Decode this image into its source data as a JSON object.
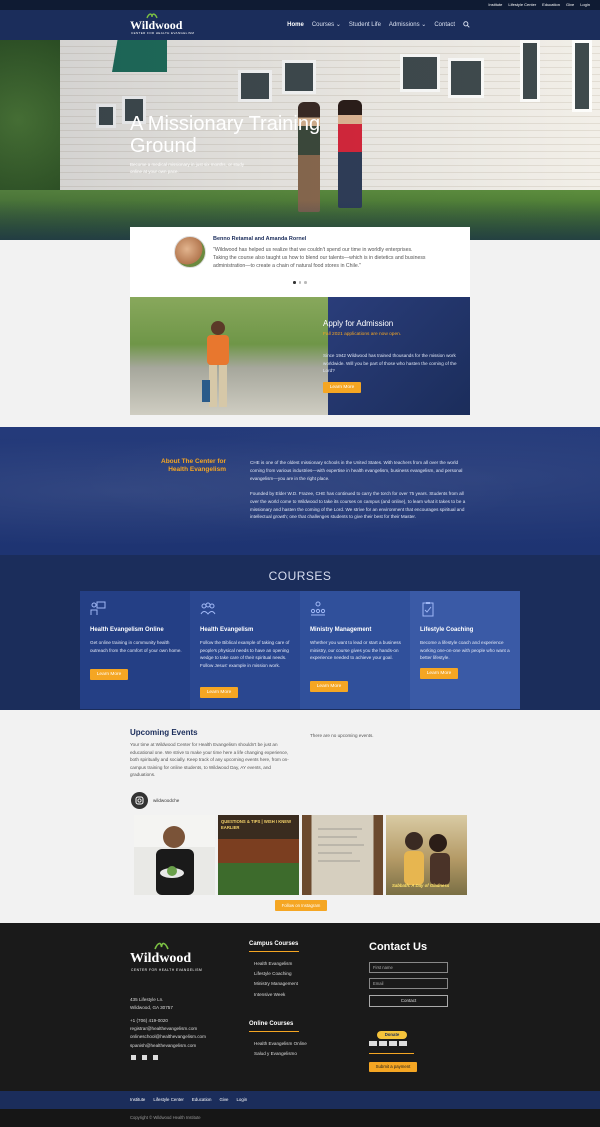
{
  "topbar": {
    "links": [
      "Institute",
      "Lifestyle Center",
      "Education",
      "Give",
      "Login"
    ]
  },
  "header": {
    "logo_word": "Wildwood",
    "logo_tagline": "CENTER FOR HEALTH EVANGELISM",
    "nav": [
      "Home",
      "Courses",
      "Student Life",
      "Admissions",
      "Contact"
    ],
    "nav_caret": "⌄"
  },
  "hero": {
    "title": "A Missionary Training Ground",
    "subtitle": "Become a medical missionary in just six months, or study online at your own pace."
  },
  "testimonial": {
    "name": "Benno Retamal and Amanda Rornel",
    "quote": "\"Wildwood has helped us realize that we couldn't spend our time in worldly enterprises. Taking the course also taught us how to blend our talents—which is in dietetics and business administration—to create a chain of natural food stores in Chile.\""
  },
  "apply": {
    "title": "Apply for Admission",
    "subtitle": "Fall 2021 applications are now open.",
    "text": "Since 1942 Wildwood has trained thousands for the mission work worldwide. Will you be part of those who hasten the coming of the Lord?",
    "button": "Learn More"
  },
  "about": {
    "title": "About The Center for Health Evangelism",
    "p1": "CHE is one of the oldest missionary schools in the United States. With teachers from all over the world coming from various industries—with expertise in health evangelism, business evangelism, and personal evangelism—you are in the right place.",
    "p2": "Founded by Elder W.D. Frazee, CHE has continued to carry the torch for over 75 years. Students from all over the world come to Wildwood to take its courses on campus (and online), to learn what it takes to be a missionary and hasten the coming of the Lord. We strive for an environment that encourages spiritual and intellectual growth; one that challenges students to give their best for their Master."
  },
  "courses": {
    "title": "COURSES",
    "items": [
      {
        "title": "Health Evangelism Online",
        "desc": "Get online training in community health outreach from the comfort of your own home.",
        "button": "Learn More",
        "bg": "#243f85",
        "icon": "online-training-icon"
      },
      {
        "title": "Health Evangelism",
        "desc": "Follow the Biblical example of taking care of people's physical needs to have an opening wedge to take care of their spiritual needs. Follow Jesus' example in mission work.",
        "button": "Learn More",
        "bg": "#2a4790",
        "icon": "group-icon"
      },
      {
        "title": "Ministry Management",
        "desc": "Whether you want to lead or start a business ministry, our course gives you the hands-on experience needed to achieve your goal.",
        "button": "Learn More",
        "bg": "#30509b",
        "icon": "team-icon"
      },
      {
        "title": "Lifestyle Coaching",
        "desc": "Become a lifestyle coach and experience working one-on-one with people who want a better lifestyle.",
        "button": "Learn More",
        "bg": "#3a5aa6",
        "icon": "clipboard-icon"
      }
    ]
  },
  "events": {
    "title": "Upcoming Events",
    "text": "Your time at Wildwood Center for Health Evangelism shouldn't be just an educational one. We strive to make your time here a life changing experience, both spiritually and socially. Keep track of any upcoming events here, from on-campus training for online students, to Wildwood Day, AY events, and graduations.",
    "empty": "There are no upcoming events.",
    "instagram_handle": "wildwoodche",
    "follow_button": "Follow on Instagram",
    "tiles": [
      {
        "icon": "photo-man-plate",
        "label": ""
      },
      {
        "icon": "photo-produce-market",
        "label": "QUESTIONS & TIPS | WISH I KNEW EARLIER"
      },
      {
        "icon": "photo-whiteboard",
        "label": ""
      },
      {
        "icon": "photo-two-women",
        "label": "Sabbath: A Day of Gladness"
      }
    ]
  },
  "footer": {
    "logo_word": "Wildwood",
    "logo_tagline": "CENTER FOR HEALTH EVANGELISM",
    "address": [
      "435 Lifestyle Ln.",
      "Wildwood, GA 30757"
    ],
    "contact": [
      "+1 (706) 419-0020",
      "registrar@healthevangelism.com",
      "onlineschool@healthevangelism.com",
      "spanish@healthevangelism.com"
    ],
    "campus_heading": "Campus Courses",
    "campus_links": [
      "Health Evangelism",
      "Lifestyle Coaching",
      "Ministry Management",
      "Intensive Week"
    ],
    "online_heading": "Online Courses",
    "online_links": [
      "Health Evangelism Online",
      "Salud y Evangelismo"
    ],
    "contact_title": "Contact Us",
    "name_placeholder": "First name",
    "email_placeholder": "Email",
    "contact_button": "Contact",
    "donate_label": "Donate",
    "submit_payment": "Submit a payment"
  },
  "bottom_nav": {
    "links": [
      "Institute",
      "Lifestyle Center",
      "Education",
      "Give",
      "Login"
    ]
  },
  "copyright": "Copyright © Wildwood Health Institute",
  "colors": {
    "navy": "#1b2d5b",
    "accent": "#f5a623",
    "footer": "#1a1a1a"
  }
}
